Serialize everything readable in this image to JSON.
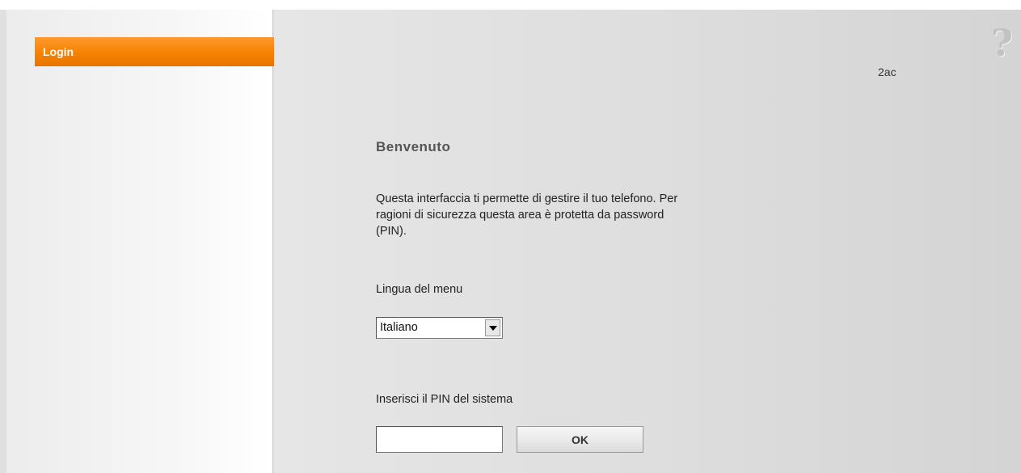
{
  "sidebar": {
    "items": [
      {
        "label": "Login",
        "active": true
      }
    ]
  },
  "header": {
    "help_icon": "question-mark-icon",
    "device_name": "2ac"
  },
  "main": {
    "title": "Benvenuto",
    "intro_text": "Questa interfaccia ti permette di gestire il tuo telefono. Per ragioni di sicurezza questa area è protetta da password (PIN).",
    "language_label": "Lingua del menu",
    "language_selected": "Italiano",
    "pin_label": "Inserisci il PIN del sistema",
    "pin_value": "",
    "ok_label": "OK"
  },
  "colors": {
    "accent": "#f68200",
    "background": "#e0e0e0"
  }
}
